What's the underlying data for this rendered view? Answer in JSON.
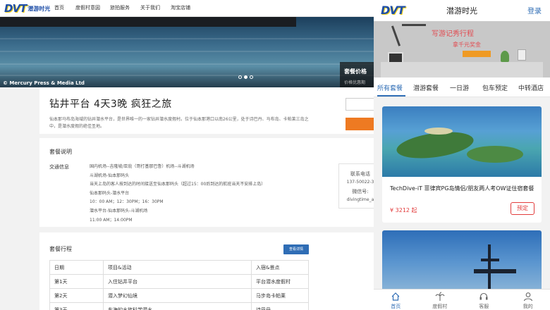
{
  "desktop": {
    "logo": {
      "mark": "DVT",
      "text": "潜游时光"
    },
    "nav": [
      "首页",
      "度假村意図",
      "旅拍服务",
      "关于我们",
      "淘宝店铺"
    ],
    "hero": {
      "credit": "© Mercury Press & Media Ltd",
      "slides": 3,
      "active_slide": 2,
      "price_title": "套餐价格",
      "price_sub": "价格优惠期"
    },
    "title": "钻井平台 4天3晚 疯狂之旅",
    "description": "仙本那马布岛海域的钻井潜水平台，是世界唯一的一家钻井潜水度假村。位于仙本那港口以南26公里，处于诗巴丹、马布岛、卡帕莱三岛之中，是潜水度假的绝佳圣地。",
    "package": {
      "title": "套餐说明",
      "transport_label": "交通信息",
      "transport_lines": [
        "国内机场--吉隆坡/亚庇（哥打基那巴鲁）机场--斗湖机场",
        "斗湖机场-仙本那码头",
        "当天上岛的客人按到达的时间接送至仙本那码头（超过15：00后到达的航班当天不安排上岛）",
        "仙本那码头-潜水平台",
        "10：00 AM；12：30PM；16：30PM",
        "潜水平台-仙本那码头-斗湖机场",
        "11:00 AM；14:00PM"
      ],
      "contact": {
        "title": "联系电话",
        "phone": "137-50022-3",
        "wechat_label": "微信号:",
        "wechat_id": "divingtime_a"
      }
    },
    "itinerary": {
      "title": "套餐行程",
      "detail_button": "查看详情",
      "columns": [
        "日期",
        "项目&活动",
        "入宿&景点"
      ],
      "rows": [
        [
          "第1天",
          "入住钻井平台",
          "平台潜水度假村"
        ],
        [
          "第2天",
          "潜入梦幻仙境",
          "马步岛卡帕莱"
        ],
        [
          "第3天",
          "东海的水族科学潜水",
          "诗巴丹"
        ]
      ]
    }
  },
  "mobile": {
    "logo": {
      "mark": "DVT"
    },
    "title": "潜游时光",
    "login": "登录",
    "banner": {
      "line1": "写游记秀行程",
      "line2": "拿千元奖金"
    },
    "tabs": [
      "所有套餐",
      "潜游套餐",
      "一日游",
      "包车预定",
      "中转酒店"
    ],
    "active_tab": 0,
    "card": {
      "title": "TechDive-iT 菲律宾PG岛情侣/朋友两人考OW证住宿套餐",
      "price": "¥ 3212 起",
      "button": "预定"
    },
    "bottom_nav": [
      {
        "label": "首页",
        "icon": "home-icon"
      },
      {
        "label": "度假村",
        "icon": "palm-tree-icon"
      },
      {
        "label": "客服",
        "icon": "headset-icon"
      },
      {
        "label": "我的",
        "icon": "user-icon"
      }
    ],
    "active_bottom": 0
  },
  "colors": {
    "brand_blue": "#2f6db5",
    "logo_blue": "#1f4fa8",
    "logo_yellow": "#f4d21a",
    "accent_orange": "#ee7a22",
    "price_red": "#e23c3c"
  }
}
